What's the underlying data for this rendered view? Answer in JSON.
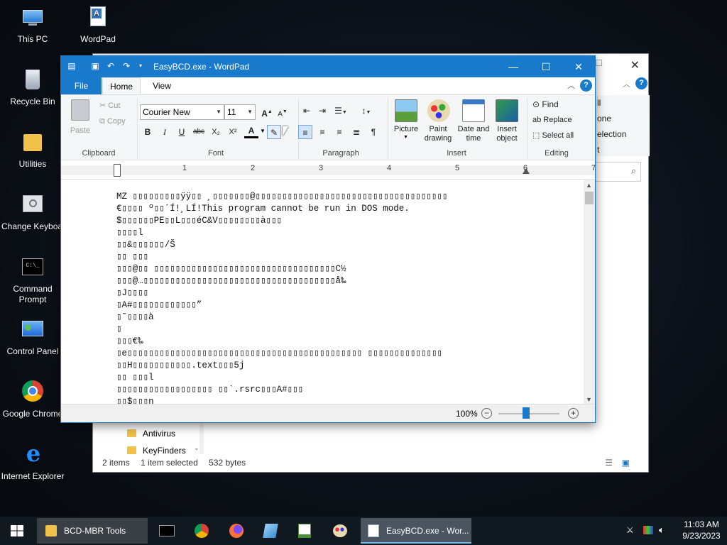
{
  "desktop": {
    "icons": [
      {
        "label": "This PC"
      },
      {
        "label": "WordPad"
      },
      {
        "label": "Recycle Bin"
      },
      {
        "label": "Utilities"
      },
      {
        "label": "Change Keyboard Layout"
      },
      {
        "label": "Command Prompt"
      },
      {
        "label": "Control Panel"
      },
      {
        "label": "Google Chrome"
      },
      {
        "label": "Internet Explorer"
      }
    ]
  },
  "explorer": {
    "ribbon_right": [
      "ll",
      "one",
      "election",
      "t"
    ],
    "sidebar": [
      {
        "label": "Antivirus"
      },
      {
        "label": "KeyFinders"
      }
    ],
    "status": {
      "items": "2 items",
      "selected": "1 item selected",
      "size": "532 bytes"
    }
  },
  "wordpad": {
    "title": "EasyBCD.exe - WordPad",
    "tabs": {
      "file": "File",
      "home": "Home",
      "view": "View"
    },
    "help": "?",
    "clipboard": {
      "paste": "Paste",
      "cut": "Cut",
      "copy": "Copy",
      "label": "Clipboard"
    },
    "font": {
      "family": "Courier New",
      "size": "11",
      "label": "Font",
      "bold": "B",
      "italic": "I",
      "underline": "U",
      "strike": "abc",
      "sub": "X₂",
      "sup": "X²",
      "color": "A"
    },
    "paragraph": {
      "label": "Paragraph"
    },
    "insert": {
      "label": "Insert",
      "picture": "Picture",
      "paint": "Paint drawing",
      "datetime": "Date and time",
      "object": "Insert object"
    },
    "editing": {
      "label": "Editing",
      "find": "Find",
      "replace": "Replace",
      "select_all": "Select all"
    },
    "ruler": [
      "1",
      "2",
      "3",
      "4",
      "5",
      "6",
      "7"
    ],
    "document": [
      "MZ ▯▯▯▯▯▯▯▯▯ÿÿ▯▯ ¸▯▯▯▯▯▯▯@▯▯▯▯▯▯▯▯▯▯▯▯▯▯▯▯▯▯▯▯▯▯▯▯▯▯▯▯▯▯▯▯▯▯▯▯",
      "€▯▯▯▯ º▯▯´Í!¸LÍ!This program cannot be run in DOS mode.",
      "$▯▯▯▯▯▯PE▯▯L▯▯▯éC&V▯▯▯▯▯▯▯▯à▯▯▯",
      "▯▯▯▯l",
      "▯▯&▯▯▯▯▯▯/Š",
      "▯▯ ▯▯▯",
      "▯▯▯@▯▯ ▯▯▯▯▯▯▯▯▯▯▯▯▯▯▯▯▯▯▯▯▯▯▯▯▯▯▯▯▯▯▯▯▯▯C½",
      "▯▯▯@…▯▯▯▯▯▯▯▯▯▯▯▯▯▯▯▯▯▯▯▯▯▯▯▯▯▯▯▯▯▯▯▯▯▯▯▯å‰",
      "▯J▯▯▯▯",
      "▯A#▯▯▯▯▯▯▯▯▯▯▯▯”",
      "▯˜▯▯▯▯à",
      "▯",
      "▯▯▯€‰",
      "▯e▯▯▯▯▯▯▯▯▯▯▯▯▯▯▯▯▯▯▯▯▯▯▯▯▯▯▯▯▯▯▯▯▯▯▯▯▯▯▯▯▯▯▯▯ ▯▯▯▯▯▯▯▯▯▯▯▯▯▯",
      "▯▯H▯▯▯▯▯▯▯▯▯▯▯.text▯▯▯5j",
      "▯▯ ▯▯▯l",
      "▯▯▯▯▯▯▯▯▯▯▯▯▯▯▯▯▯▯ ▯▯`.rsrc▯▯▯A#▯▯▯",
      "▯▯$▯▯▯n"
    ],
    "zoom": "100%",
    "zoom_level": 0.45
  },
  "taskbar": {
    "items": [
      {
        "label": "BCD-MBR Tools"
      },
      {
        "label": "EasyBCD.exe - Wor..."
      }
    ],
    "time": "11:03 AM",
    "date": "9/23/2023"
  }
}
